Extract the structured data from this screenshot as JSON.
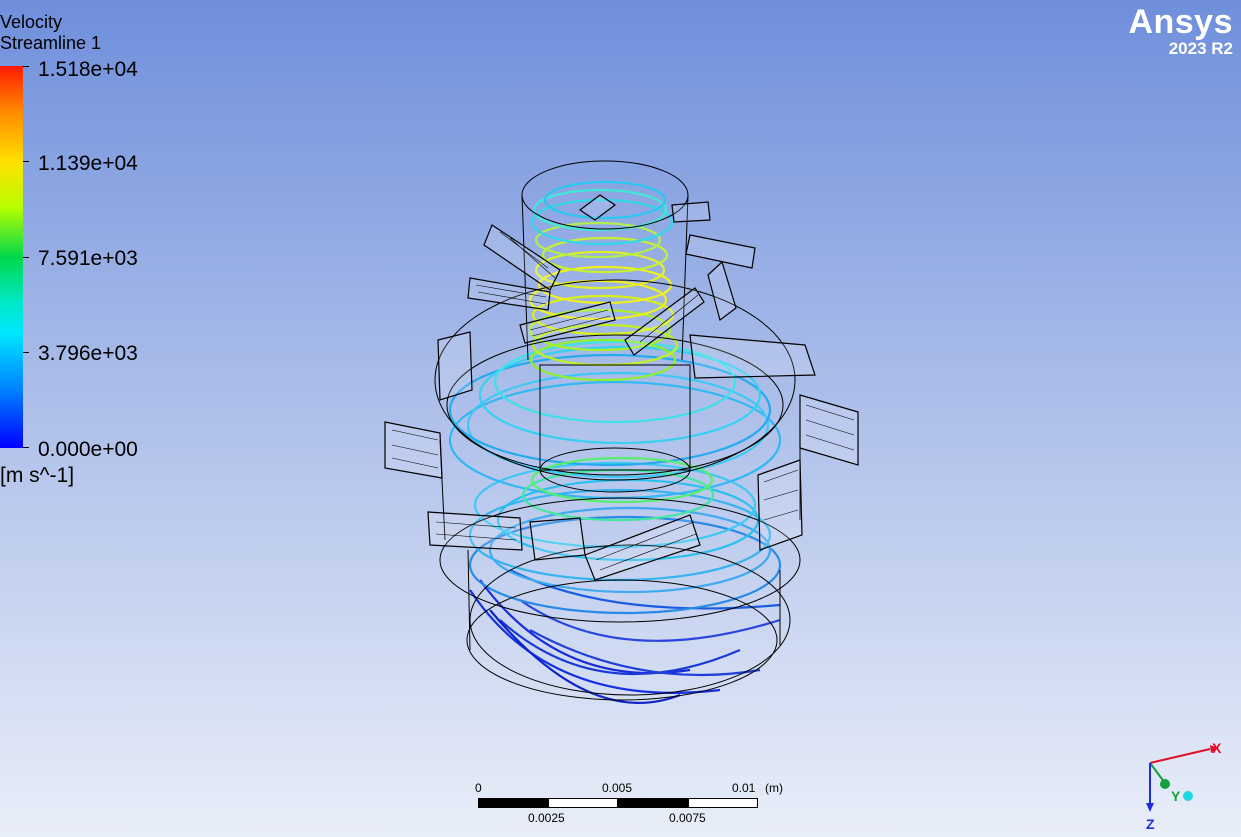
{
  "legend": {
    "title": "Velocity",
    "subtitle": "Streamline 1",
    "ticks": [
      "1.518e+04",
      "1.139e+04",
      "7.591e+03",
      "3.796e+03",
      "0.000e+00"
    ],
    "unit": "[m s^-1]"
  },
  "brand": {
    "name": "Ansys",
    "version": "2023 R2"
  },
  "scale_bar": {
    "top_labels": [
      "0",
      "0.005",
      "0.01"
    ],
    "unit": "(m)",
    "bottom_labels": [
      "0.0025",
      "0.0075"
    ]
  },
  "triad": {
    "x_label": "X",
    "y_label": "Y",
    "z_label": "Z"
  },
  "colors": {
    "background_top": "#6f8fdc",
    "background_bottom": "#e9eef8",
    "brand_text": "#ffffff",
    "axis_x": "#e0102a",
    "axis_y": "#12a03a",
    "axis_z": "#1a2ee0"
  }
}
